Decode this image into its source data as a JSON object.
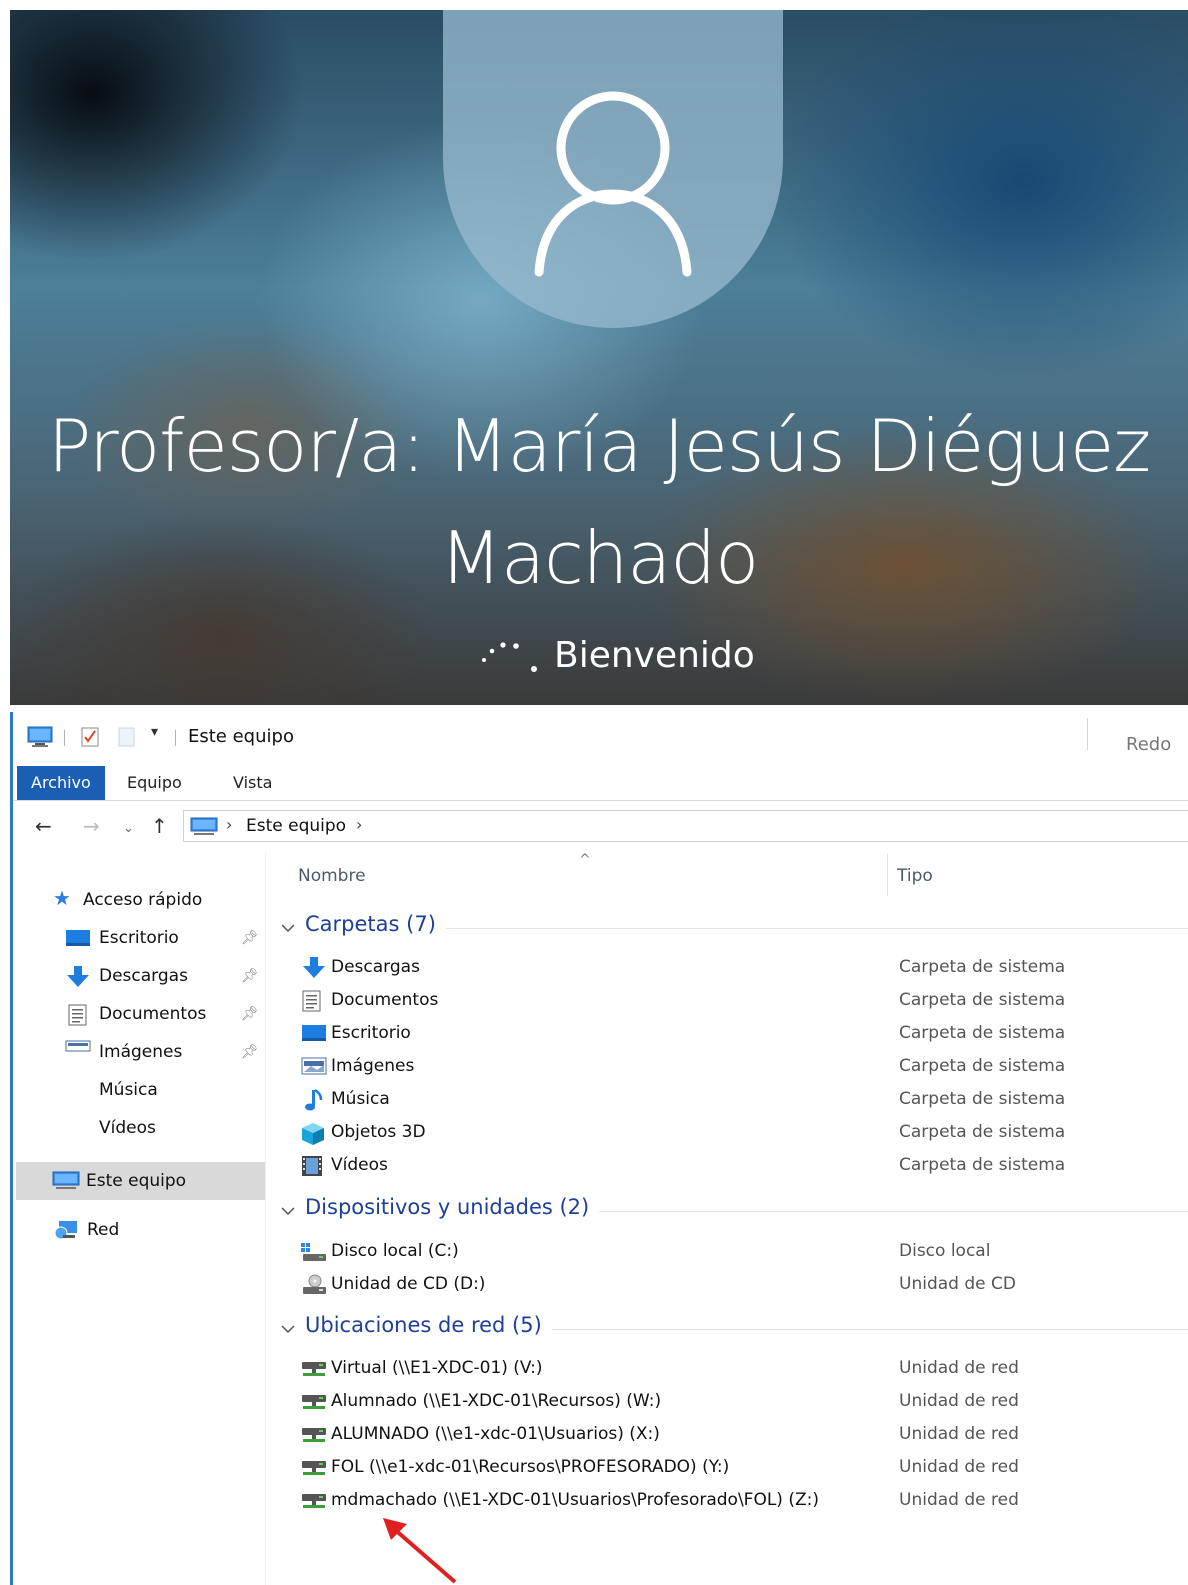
{
  "login": {
    "user_name": "Profesor/a: María Jesús Diéguez Machado",
    "status": "Bienvenido"
  },
  "explorer": {
    "title": "Este equipo",
    "title_right_text": "Redo",
    "ribbon_tabs": [
      "Archivo",
      "Equipo",
      "Vista"
    ],
    "address": "Este equipo",
    "columns": {
      "name": "Nombre",
      "type": "Tipo"
    },
    "nav": {
      "quick_access": "Acceso rápido",
      "pinned": [
        {
          "label": "Escritorio",
          "icon": "desktop-icon"
        },
        {
          "label": "Descargas",
          "icon": "download-icon"
        },
        {
          "label": "Documentos",
          "icon": "document-icon"
        },
        {
          "label": "Imágenes",
          "icon": "images-icon"
        }
      ],
      "unpinned": [
        "Música",
        "Vídeos"
      ],
      "this_pc": "Este equipo",
      "network": "Red"
    },
    "groups": {
      "folders": {
        "title": "Carpetas (7)",
        "items": [
          {
            "name": "Descargas",
            "type": "Carpeta de sistema",
            "icon": "download-icon"
          },
          {
            "name": "Documentos",
            "type": "Carpeta de sistema",
            "icon": "document-icon"
          },
          {
            "name": "Escritorio",
            "type": "Carpeta de sistema",
            "icon": "desktop-icon"
          },
          {
            "name": "Imágenes",
            "type": "Carpeta de sistema",
            "icon": "images-icon"
          },
          {
            "name": "Música",
            "type": "Carpeta de sistema",
            "icon": "music-icon"
          },
          {
            "name": "Objetos 3D",
            "type": "Carpeta de sistema",
            "icon": "cube-icon"
          },
          {
            "name": "Vídeos",
            "type": "Carpeta de sistema",
            "icon": "video-icon"
          }
        ]
      },
      "devices": {
        "title": "Dispositivos y unidades (2)",
        "items": [
          {
            "name": "Disco local (C:)",
            "type": "Disco local",
            "icon": "local-disk-icon"
          },
          {
            "name": "Unidad de CD (D:)",
            "type": "Unidad de CD",
            "icon": "cd-drive-icon"
          }
        ]
      },
      "network": {
        "title": "Ubicaciones de red (5)",
        "items": [
          {
            "name": "Virtual (\\\\E1-XDC-01) (V:)",
            "type": "Unidad de red",
            "icon": "network-drive-icon"
          },
          {
            "name": "Alumnado (\\\\E1-XDC-01\\Recursos) (W:)",
            "type": "Unidad de red",
            "icon": "network-drive-icon"
          },
          {
            "name": "ALUMNADO (\\\\e1-xdc-01\\Usuarios) (X:)",
            "type": "Unidad de red",
            "icon": "network-drive-icon"
          },
          {
            "name": "FOL (\\\\e1-xdc-01\\Recursos\\PROFESORADO) (Y:)",
            "type": "Unidad de red",
            "icon": "network-drive-icon"
          },
          {
            "name": "mdmachado (\\\\E1-XDC-01\\Usuarios\\Profesorado\\FOL) (Z:)",
            "type": "Unidad de red",
            "icon": "network-drive-icon"
          }
        ]
      }
    }
  },
  "colors": {
    "accent": "#1a5fb4",
    "group_title": "#1e3f9a",
    "annotation_arrow": "#e02020"
  }
}
